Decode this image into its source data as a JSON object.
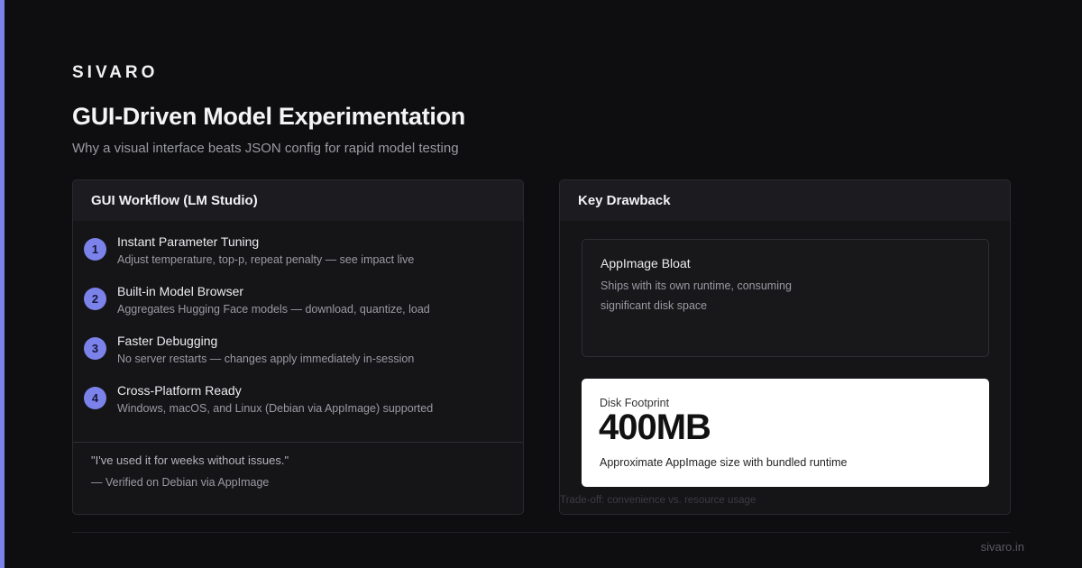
{
  "brand": "SIVARO",
  "title": "GUI-Driven Model Experimentation",
  "subtitle": "Why a visual interface beats JSON config for rapid model testing",
  "workflow": {
    "heading": "GUI Workflow (LM Studio)",
    "steps": [
      {
        "num": "1",
        "title": "Instant Parameter Tuning",
        "desc": "Adjust temperature, top-p, repeat penalty — see impact live"
      },
      {
        "num": "2",
        "title": "Built-in Model Browser",
        "desc": "Aggregates Hugging Face models — download, quantize, load"
      },
      {
        "num": "3",
        "title": "Faster Debugging",
        "desc": "No server restarts — changes apply immediately in-session"
      },
      {
        "num": "4",
        "title": "Cross-Platform Ready",
        "desc": "Windows, macOS, and Linux (Debian via AppImage) supported"
      }
    ],
    "quote": "\"I've used it for weeks without issues.\"",
    "attribution": "— Verified on Debian via AppImage"
  },
  "drawback": {
    "heading": "Key Drawback",
    "item_title": "AppImage Bloat",
    "item_desc": "Ships with its own runtime, consuming significant disk space",
    "stat_label": "Disk Footprint",
    "stat_value": "400MB",
    "stat_note": "Approximate AppImage size with bundled runtime",
    "tradeoff": "Trade-off: convenience vs. resource usage"
  },
  "footer": {
    "domain": "sivaro.in"
  },
  "colors": {
    "accent": "#7b83eb",
    "background": "#0e0e10",
    "card": "#151518"
  }
}
